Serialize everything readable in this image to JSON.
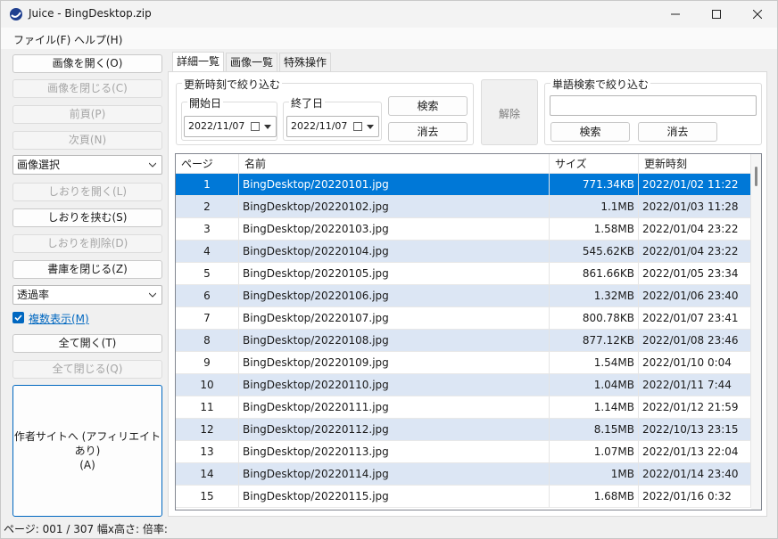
{
  "window": {
    "title": "Juice - BingDesktop.zip"
  },
  "menu": [
    {
      "label": "ファイル(F)"
    },
    {
      "label": "ヘルプ(H)"
    }
  ],
  "sidebar": {
    "open_image": "画像を開く(O)",
    "close_image": "画像を閉じる(C)",
    "prev_page": "前頁(P)",
    "next_page": "次頁(N)",
    "image_select": "画像選択",
    "open_bookmark": "しおりを開く(L)",
    "insert_bookmark": "しおりを挟む(S)",
    "delete_bookmark": "しおりを削除(D)",
    "close_library": "書庫を閉じる(Z)",
    "transparency": "透過率",
    "multi_display": "複数表示(M)",
    "open_all": "全て開く(T)",
    "close_all": "全て閉じる(Q)",
    "author_site_line1": "作者サイトへ (アフィリエイトあり)",
    "author_site_line2": "(A)"
  },
  "tabs": [
    {
      "label": "詳細一覧"
    },
    {
      "label": "画像一覧"
    },
    {
      "label": "特殊操作"
    }
  ],
  "filter": {
    "date_group": "更新時刻で絞り込む",
    "start_label": "開始日",
    "start_value": "2022/11/07",
    "end_label": "終了日",
    "end_value": "2022/11/07",
    "search": "検索",
    "clear": "消去",
    "release": "解除",
    "word_group": "単語検索で絞り込む",
    "word_search": "検索",
    "word_clear": "消去"
  },
  "table": {
    "headers": [
      "ページ",
      "名前",
      "サイズ",
      "更新時刻"
    ],
    "rows": [
      {
        "page": "1",
        "name": "BingDesktop/20220101.jpg",
        "size": "771.34KB",
        "date": "2022/01/02 11:22"
      },
      {
        "page": "2",
        "name": "BingDesktop/20220102.jpg",
        "size": "1.1MB",
        "date": "2022/01/03 11:28"
      },
      {
        "page": "3",
        "name": "BingDesktop/20220103.jpg",
        "size": "1.58MB",
        "date": "2022/01/04 23:22"
      },
      {
        "page": "4",
        "name": "BingDesktop/20220104.jpg",
        "size": "545.62KB",
        "date": "2022/01/04 23:22"
      },
      {
        "page": "5",
        "name": "BingDesktop/20220105.jpg",
        "size": "861.66KB",
        "date": "2022/01/05 23:34"
      },
      {
        "page": "6",
        "name": "BingDesktop/20220106.jpg",
        "size": "1.32MB",
        "date": "2022/01/06 23:40"
      },
      {
        "page": "7",
        "name": "BingDesktop/20220107.jpg",
        "size": "800.78KB",
        "date": "2022/01/07 23:41"
      },
      {
        "page": "8",
        "name": "BingDesktop/20220108.jpg",
        "size": "877.12KB",
        "date": "2022/01/08 23:46"
      },
      {
        "page": "9",
        "name": "BingDesktop/20220109.jpg",
        "size": "1.54MB",
        "date": "2022/01/10 0:04"
      },
      {
        "page": "10",
        "name": "BingDesktop/20220110.jpg",
        "size": "1.04MB",
        "date": "2022/01/11 7:44"
      },
      {
        "page": "11",
        "name": "BingDesktop/20220111.jpg",
        "size": "1.14MB",
        "date": "2022/01/12 21:59"
      },
      {
        "page": "12",
        "name": "BingDesktop/20220112.jpg",
        "size": "8.15MB",
        "date": "2022/10/13 23:15"
      },
      {
        "page": "13",
        "name": "BingDesktop/20220113.jpg",
        "size": "1.07MB",
        "date": "2022/01/13 22:04"
      },
      {
        "page": "14",
        "name": "BingDesktop/20220114.jpg",
        "size": "1MB",
        "date": "2022/01/14 23:40"
      },
      {
        "page": "15",
        "name": "BingDesktop/20220115.jpg",
        "size": "1.68MB",
        "date": "2022/01/16 0:32"
      }
    ]
  },
  "status": {
    "text": "ページ: 001 / 307  幅x高さ:  倍率:"
  },
  "colors": {
    "accent": "#0067c0",
    "selected_row": "#0078d7",
    "alt_row": "#dce6f4"
  }
}
